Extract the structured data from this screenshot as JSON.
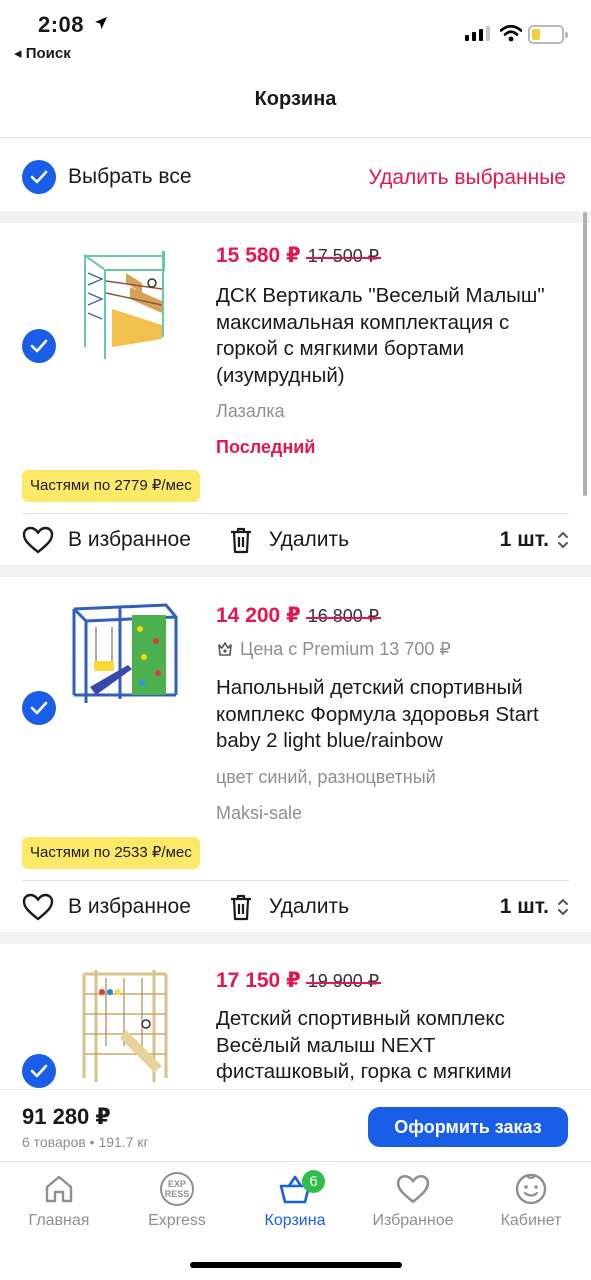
{
  "status": {
    "time": "2:08",
    "back_label": "◂ Поиск"
  },
  "header": {
    "title": "Корзина"
  },
  "select_all": {
    "label": "Выбрать все",
    "delete_label": "Удалить выбранные"
  },
  "items": [
    {
      "price": "15 580 ₽",
      "old_price": "17 500 ₽",
      "title": "ДСК Вертикаль \"Веселый Малыш\" максимальная комплектация с горкой с мягкими бортами (изумрудный)",
      "meta": "Лазалка",
      "tag": "Последний",
      "installment": "Частями по 2779 ₽/мес",
      "fav_label": "В избранное",
      "delete_label": "Удалить",
      "qty": "1 шт."
    },
    {
      "price": "14 200 ₽",
      "old_price": "16 800 ₽",
      "premium": "Цена с Premium 13 700 ₽",
      "title": "Напольный детский спортивный комплекс Формула здоровья Start baby 2 light blue/rainbow",
      "meta": "цвет синий, разноцветный",
      "seller": "Maksi-sale",
      "installment": "Частями по 2533 ₽/мес",
      "fav_label": "В избранное",
      "delete_label": "Удалить",
      "qty": "1 шт."
    },
    {
      "price": "17 150 ₽",
      "old_price": "19 900 ₽",
      "title": "Детский спортивный комплекс Весёлый малыш NEXT фисташковый, горка с мягкими"
    }
  ],
  "summary": {
    "total": "91 280 ₽",
    "sub": "6 товаров • 191.7 кг",
    "order_label": "Оформить заказ"
  },
  "tabs": [
    {
      "label": "Главная",
      "icon": "home-icon"
    },
    {
      "label": "Express",
      "icon": "express-icon",
      "icon_text_top": "EXP",
      "icon_text_bottom": "RESS"
    },
    {
      "label": "Корзина",
      "icon": "basket-icon",
      "badge": "6",
      "active": true
    },
    {
      "label": "Избранное",
      "icon": "heart-icon"
    },
    {
      "label": "Кабинет",
      "icon": "smile-icon"
    }
  ],
  "colors": {
    "accent": "#1a5ee8",
    "price": "#e5164f",
    "installment_bg": "#fde968",
    "badge": "#2fbf4a"
  }
}
